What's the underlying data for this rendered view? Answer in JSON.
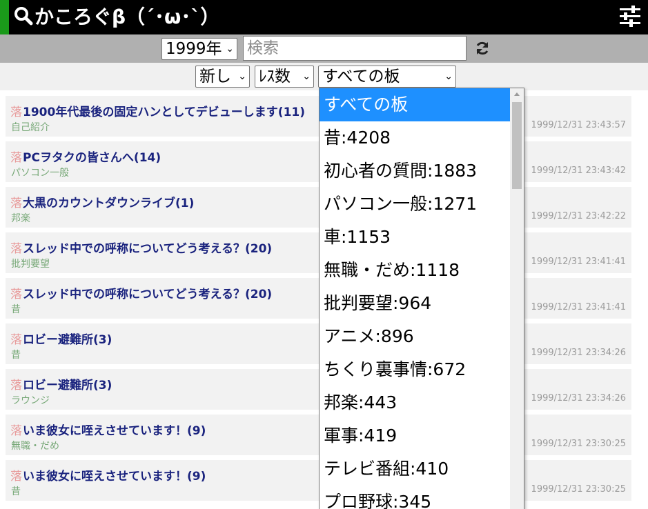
{
  "header": {
    "logo_text": "かころぐβ（´･ω･`）"
  },
  "search": {
    "year_value": "1999年",
    "placeholder": "検索"
  },
  "filters": {
    "order_value": "新し",
    "count_value": "ﾚｽ数",
    "board_value": "すべての板"
  },
  "threads": [
    {
      "mark": "落",
      "title": "1900年代最後の固定ハンとしてデビューします(11)",
      "board": "自己紹介",
      "time": "1999/12/31 23:43:57"
    },
    {
      "mark": "落",
      "title": "PCヲタクの皆さんへ(14)",
      "board": "パソコン一般",
      "time": "1999/12/31 23:43:42"
    },
    {
      "mark": "落",
      "title": "大黒のカウントダウンライブ(1)",
      "board": "邦楽",
      "time": "1999/12/31 23:42:22"
    },
    {
      "mark": "落",
      "title": "スレッド中での呼称についてどう考える？(20)",
      "board": "批判要望",
      "time": "1999/12/31 23:41:41"
    },
    {
      "mark": "落",
      "title": "スレッド中での呼称についてどう考える？(20)",
      "board": "昔",
      "time": "1999/12/31 23:41:41"
    },
    {
      "mark": "落",
      "title": "ロビー避難所(3)",
      "board": "昔",
      "time": "1999/12/31 23:34:26"
    },
    {
      "mark": "落",
      "title": "ロビー避難所(3)",
      "board": "ラウンジ",
      "time": "1999/12/31 23:34:26"
    },
    {
      "mark": "落",
      "title": "いま彼女に咥えさせています！(9)",
      "board": "無職・だめ",
      "time": "1999/12/31 23:30:25"
    },
    {
      "mark": "落",
      "title": "いま彼女に咥えさせています！(9)",
      "board": "昔",
      "time": "1999/12/31 23:30:25"
    }
  ],
  "board_dropdown": {
    "options": [
      "すべての板",
      "昔:4208",
      "初心者の質問:1883",
      "パソコン一般:1271",
      "車:1153",
      "無職・だめ:1118",
      "批判要望:964",
      "アニメ:896",
      "ちくり裏事情:672",
      "邦楽:443",
      "軍事:419",
      "テレビ番組:410",
      "プロ野球:345"
    ],
    "selected_index": 0
  },
  "icons": {
    "search": "search-icon",
    "settings": "sliders-icon",
    "refresh": "refresh-icon"
  },
  "colors": {
    "header_bg": "#000000",
    "header_accent": "#1a9a1a",
    "thread_title": "#1a237e",
    "board_label": "#77a877",
    "selected_option": "#1e90ff"
  }
}
